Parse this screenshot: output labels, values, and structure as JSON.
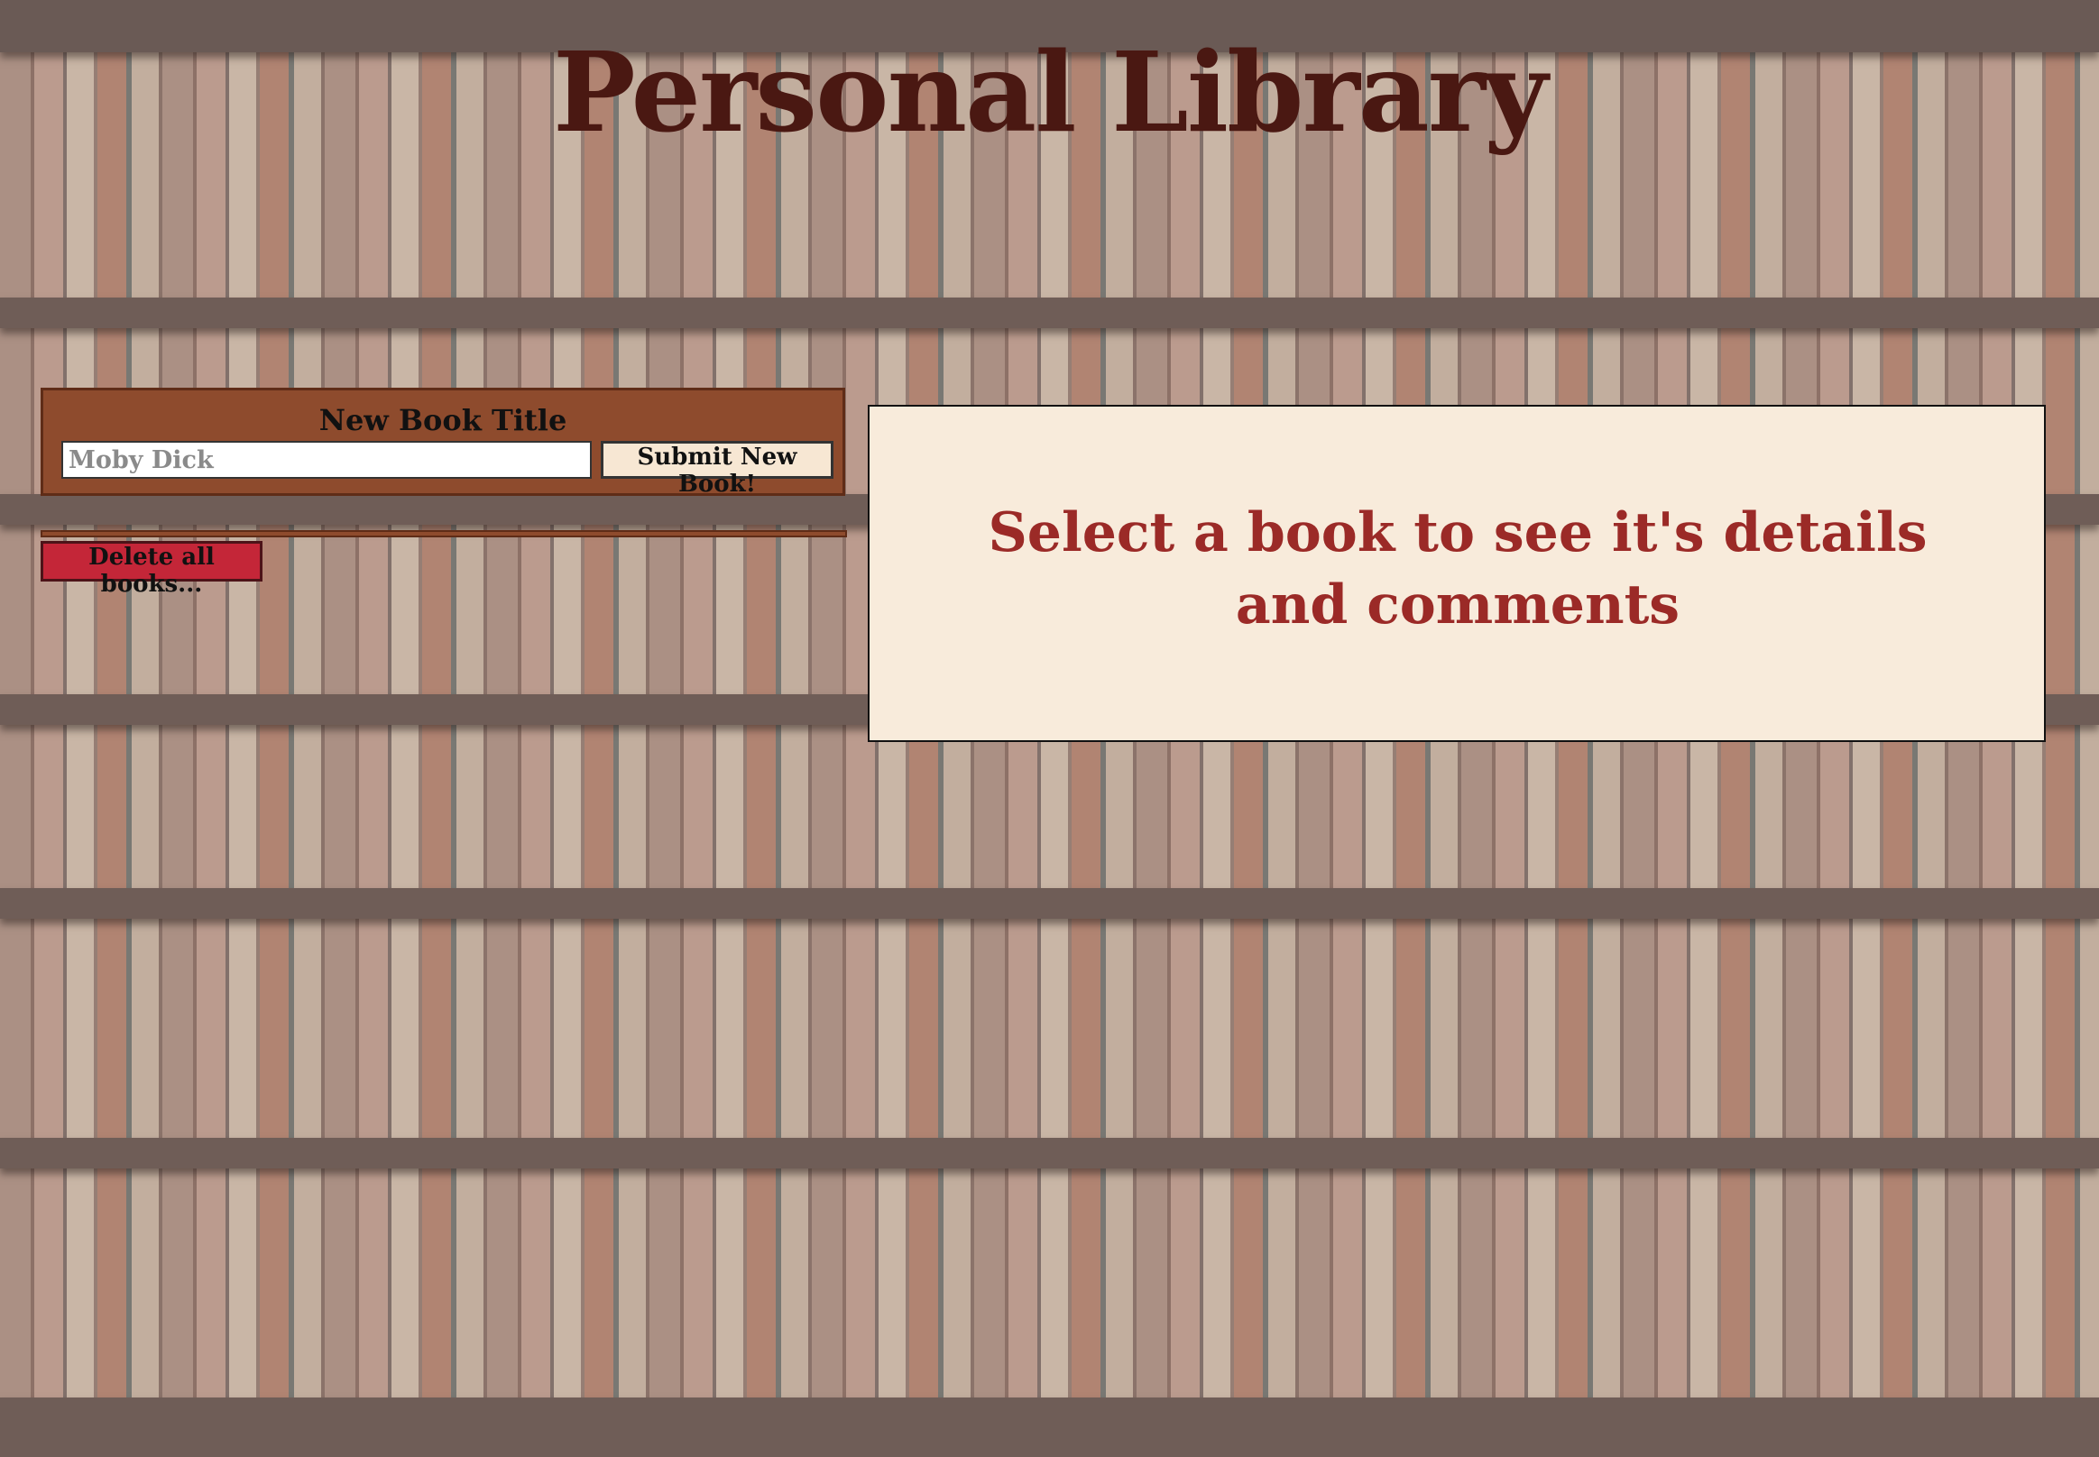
{
  "page": {
    "title": "Personal Library"
  },
  "new_book_form": {
    "label": "New Book Title",
    "input_placeholder": "Moby Dick",
    "input_value": "",
    "submit_label": "Submit New Book!"
  },
  "book_list": {
    "items": []
  },
  "delete_all": {
    "label": "Delete all books..."
  },
  "detail": {
    "message": "Select a book to see it's details and comments"
  },
  "colors": {
    "title": "#4a1812",
    "form_background": "#8e4b2d",
    "submit_background": "#f7e7d3",
    "delete_background": "#c42638",
    "detail_background": "#f8ebdb",
    "detail_text": "#9b2a27"
  }
}
